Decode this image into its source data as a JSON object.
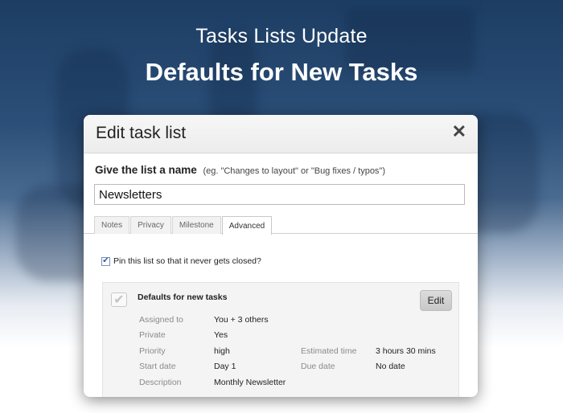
{
  "hero": {
    "subtitle": "Tasks Lists Update",
    "title": "Defaults for New Tasks"
  },
  "dialog": {
    "title": "Edit task list",
    "close_icon": "close-icon",
    "name_label": "Give the list a name",
    "name_hint": "(eg. \"Changes to layout\" or \"Bug fixes / typos\")",
    "name_value": "Newsletters",
    "tabs": [
      {
        "label": "Notes",
        "active": false
      },
      {
        "label": "Privacy",
        "active": false
      },
      {
        "label": "Milestone",
        "active": false
      },
      {
        "label": "Advanced",
        "active": true
      }
    ],
    "pin_label": "Pin this list so that it never gets closed?",
    "pin_checked": true,
    "defaults": {
      "title": "Defaults for new tasks",
      "edit_label": "Edit",
      "assigned_label": "Assigned to",
      "assigned_value": "You + 3 others",
      "private_label": "Private",
      "private_value": "Yes",
      "priority_label": "Priority",
      "priority_value": "high",
      "estimated_label": "Estimated time",
      "estimated_value": "3 hours 30 mins",
      "start_label": "Start date",
      "start_value": "Day 1",
      "due_label": "Due date",
      "due_value": "No date",
      "description_label": "Description",
      "description_value": "Monthly Newsletter"
    }
  },
  "colors": {
    "background_top": "#1d3d63",
    "background_bottom": "#ffffff",
    "checkbox_accent": "#2a5bb0"
  }
}
